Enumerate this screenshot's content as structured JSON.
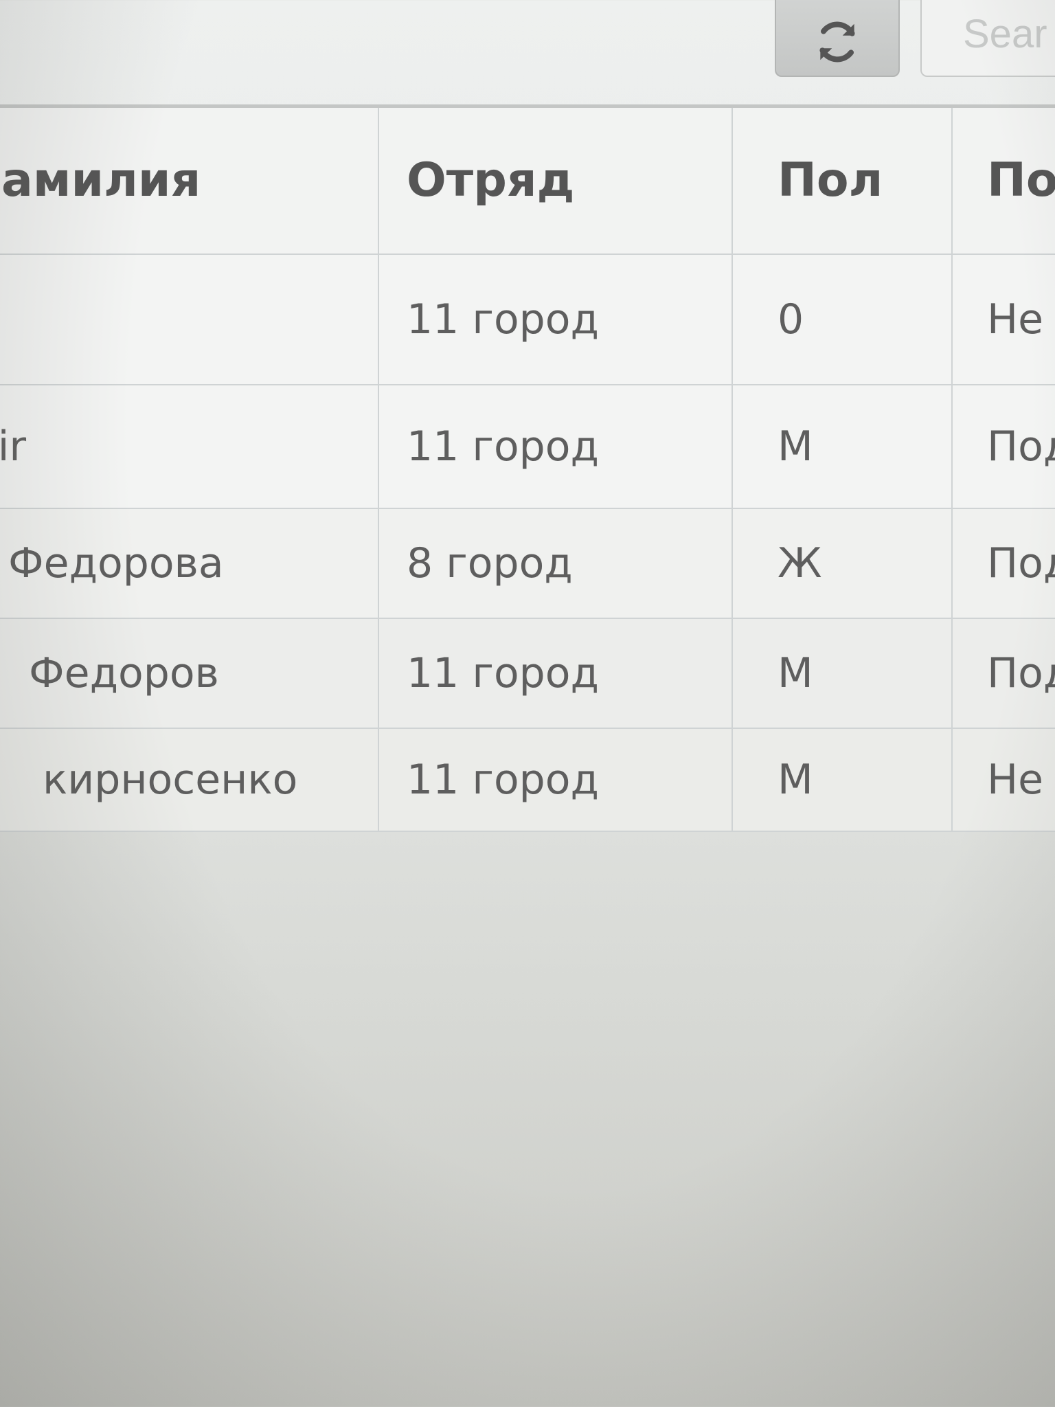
{
  "toolbar": {
    "refresh_icon": "refresh-icon",
    "search_placeholder": "Sear"
  },
  "table": {
    "columns": [
      "амилия",
      "Отряд",
      "Пол",
      "По"
    ],
    "rows": [
      [
        "",
        "11 город",
        "0",
        "Не п"
      ],
      [
        "kir",
        "11 город",
        "М",
        "Подт"
      ],
      [
        "Федорова",
        "8 город",
        "Ж",
        "Подтв"
      ],
      [
        "Федоров",
        "11 город",
        "М",
        "Подтве"
      ],
      [
        "кирносенко",
        "11 город",
        "М",
        "Не подт"
      ]
    ]
  }
}
